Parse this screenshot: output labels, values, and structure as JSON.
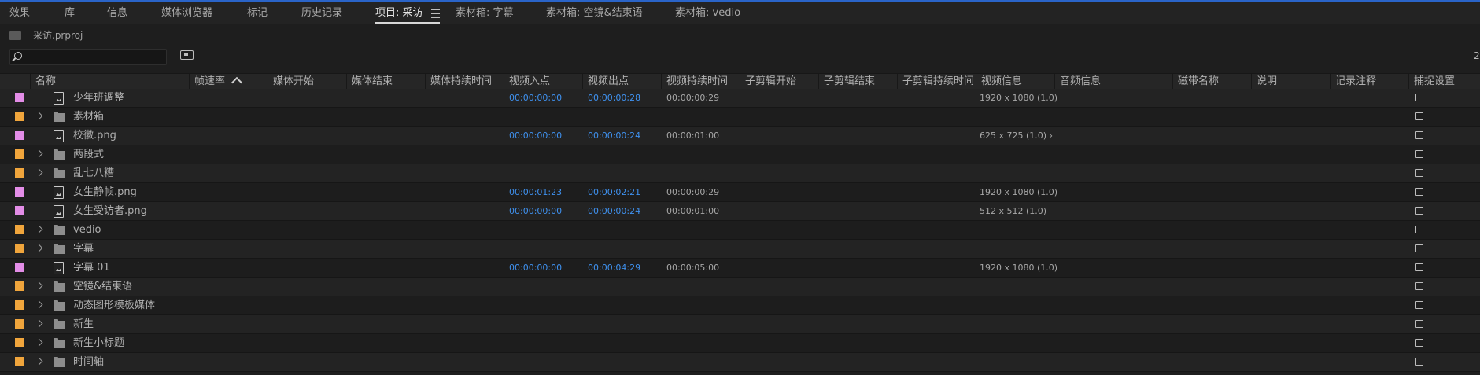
{
  "tabs": [
    {
      "label": "效果"
    },
    {
      "label": "库"
    },
    {
      "label": "信息"
    },
    {
      "label": "媒体浏览器"
    },
    {
      "label": "标记"
    },
    {
      "label": "历史记录"
    },
    {
      "label": "项目: 采访",
      "active": true
    },
    {
      "label": "素材箱: 字幕"
    },
    {
      "label": "素材箱: 空镜&结束语"
    },
    {
      "label": "素材箱: vedio"
    }
  ],
  "project": {
    "filename": "采访.prproj"
  },
  "search": {
    "value": "",
    "placeholder": ""
  },
  "edge_glyph": "2",
  "columns": {
    "name": "名称",
    "framerate": "帧速率",
    "media_start": "媒体开始",
    "media_end": "媒体结束",
    "media_duration": "媒体持续时间",
    "video_in": "视频入点",
    "video_out": "视频出点",
    "video_duration": "视频持续时间",
    "sub_start": "子剪辑开始",
    "sub_end": "子剪辑结束",
    "sub_duration": "子剪辑持续时间",
    "video_info": "视频信息",
    "audio_info": "音频信息",
    "tape_name": "磁带名称",
    "description": "说明",
    "log_note": "记录注释",
    "capture": "捕捉设置"
  },
  "colors": {
    "label_violet": "#e38de7",
    "label_orange": "#f0a53c",
    "timecode_blue": "#3f91ef",
    "accent_line": "#2a64c8"
  },
  "items": [
    {
      "type": "sequence",
      "label_color": "violet",
      "name": "少年班调整",
      "video_in": "00;00;00;00",
      "video_out": "00;00;00;28",
      "video_duration": "00;00;00;29",
      "video_info": "1920 x 1080 (1.0)"
    },
    {
      "type": "bin",
      "label_color": "orange",
      "name": "素材箱"
    },
    {
      "type": "file",
      "label_color": "violet",
      "name": "校徽.png",
      "video_in": "00:00:00:00",
      "video_out": "00:00:00:24",
      "video_duration": "00:00:01:00",
      "video_info": "625 x 725 (1.0) ›"
    },
    {
      "type": "bin",
      "label_color": "orange",
      "name": "两段式"
    },
    {
      "type": "bin",
      "label_color": "orange",
      "name": "乱七八糟"
    },
    {
      "type": "file",
      "label_color": "violet",
      "name": "女生静帧.png",
      "video_in": "00:00:01:23",
      "video_out": "00:00:02:21",
      "video_duration": "00:00:00:29",
      "video_info": "1920 x 1080 (1.0)"
    },
    {
      "type": "file",
      "label_color": "violet",
      "name": "女生受访者.png",
      "video_in": "00:00:00:00",
      "video_out": "00:00:00:24",
      "video_duration": "00:00:01:00",
      "video_info": "512 x 512 (1.0)"
    },
    {
      "type": "bin",
      "label_color": "orange",
      "name": "vedio"
    },
    {
      "type": "bin",
      "label_color": "orange",
      "name": "字幕"
    },
    {
      "type": "file",
      "label_color": "violet",
      "name": "字幕 01",
      "video_in": "00:00:00:00",
      "video_out": "00:00:04:29",
      "video_duration": "00:00:05:00",
      "video_info": "1920 x 1080 (1.0)"
    },
    {
      "type": "bin",
      "label_color": "orange",
      "name": "空镜&结束语"
    },
    {
      "type": "bin",
      "label_color": "orange",
      "name": "动态图形模板媒体"
    },
    {
      "type": "bin",
      "label_color": "orange",
      "name": "新生"
    },
    {
      "type": "bin",
      "label_color": "orange",
      "name": "新生小标题"
    },
    {
      "type": "bin",
      "label_color": "orange",
      "name": "时间轴"
    }
  ]
}
